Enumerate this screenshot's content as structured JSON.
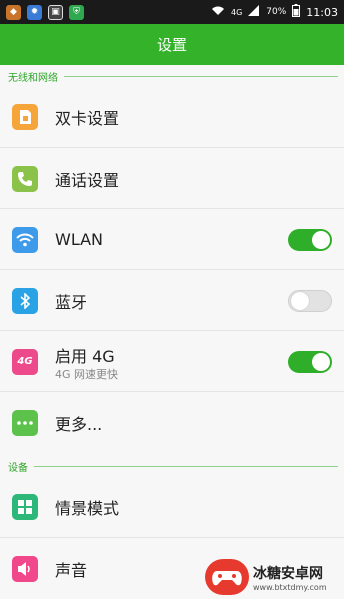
{
  "status_bar": {
    "time": "11:03",
    "battery": "70%",
    "network": "4G",
    "icons": [
      "notification-icon-1",
      "notification-icon-2",
      "screenshot-icon",
      "security-icon"
    ]
  },
  "header": {
    "title": "设置"
  },
  "sections": [
    {
      "title": "无线和网络",
      "items": [
        {
          "label": "双卡设置",
          "icon": "dual-sim-icon",
          "color": "#f5a53a"
        },
        {
          "label": "通话设置",
          "icon": "phone-icon",
          "color": "#8bc34a"
        },
        {
          "label": "WLAN",
          "icon": "wifi-icon",
          "color": "#3d9be9",
          "toggle": "on"
        },
        {
          "label": "蓝牙",
          "icon": "bluetooth-icon",
          "color": "#29a3e6",
          "toggle": "off"
        },
        {
          "label": "启用 4G",
          "sublabel": "4G 网速更快",
          "icon": "4g-icon",
          "color": "#ec4a8a",
          "toggle": "on"
        },
        {
          "label": "更多...",
          "icon": "more-icon",
          "color": "#5cc24c"
        }
      ]
    },
    {
      "title": "设备",
      "items": [
        {
          "label": "情景模式",
          "icon": "profile-mode-icon",
          "color": "#2db87a"
        },
        {
          "label": "声音",
          "icon": "sound-icon",
          "color": "#f0488a"
        }
      ]
    }
  ],
  "watermark": {
    "title": "冰糖安卓网",
    "url": "www.btxtdmy.com"
  }
}
